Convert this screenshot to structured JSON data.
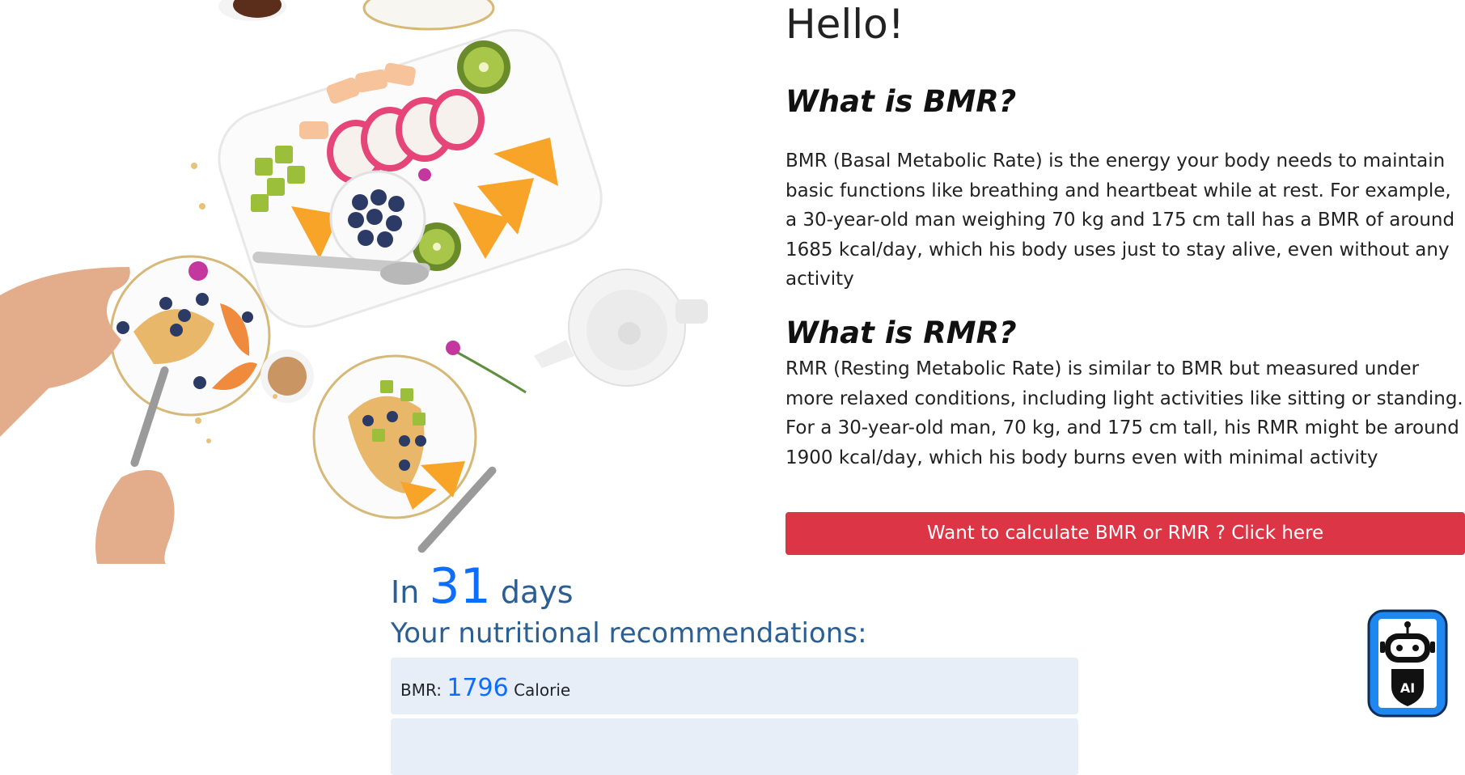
{
  "hero": {
    "image_label": "Breakfast table with fruit platter, crepes, blueberries, tea pot and coffee"
  },
  "info": {
    "greeting": "Hello!",
    "bmr": {
      "title": "What is BMR?",
      "text": "BMR (Basal Metabolic Rate) is the energy your body needs to maintain basic functions like breathing and heartbeat while at rest. For example, a 30-year-old man weighing 70 kg and 175 cm tall has a BMR of around 1685 kcal/day, which his body uses just to stay alive, even without any activity"
    },
    "rmr": {
      "title": "What is RMR?",
      "text": "RMR (Resting Metabolic Rate) is similar to BMR but measured under more relaxed conditions, including light activities like sitting or standing. For a 30-year-old man, 70 kg, and 175 cm tall, his RMR might be around 1900 kcal/day, which his body burns even with minimal activity"
    },
    "cta_label": "Want to calculate BMR or RMR ? Click here"
  },
  "results": {
    "days_prefix": "In",
    "days_value": "31",
    "days_suffix": "days",
    "recommendations_title": "Your nutritional recommendations:",
    "items": [
      {
        "label": "BMR:",
        "value": "1796",
        "unit": "Calorie"
      },
      {
        "label": "",
        "value": "",
        "unit": ""
      }
    ]
  },
  "ai_button": {
    "icon": "robot-icon",
    "badge": "AI"
  },
  "colors": {
    "cta": "#dc3545",
    "accent_blue": "#0d6efd",
    "heading_blue": "#2b5f93",
    "card_bg": "#e7eef7"
  }
}
